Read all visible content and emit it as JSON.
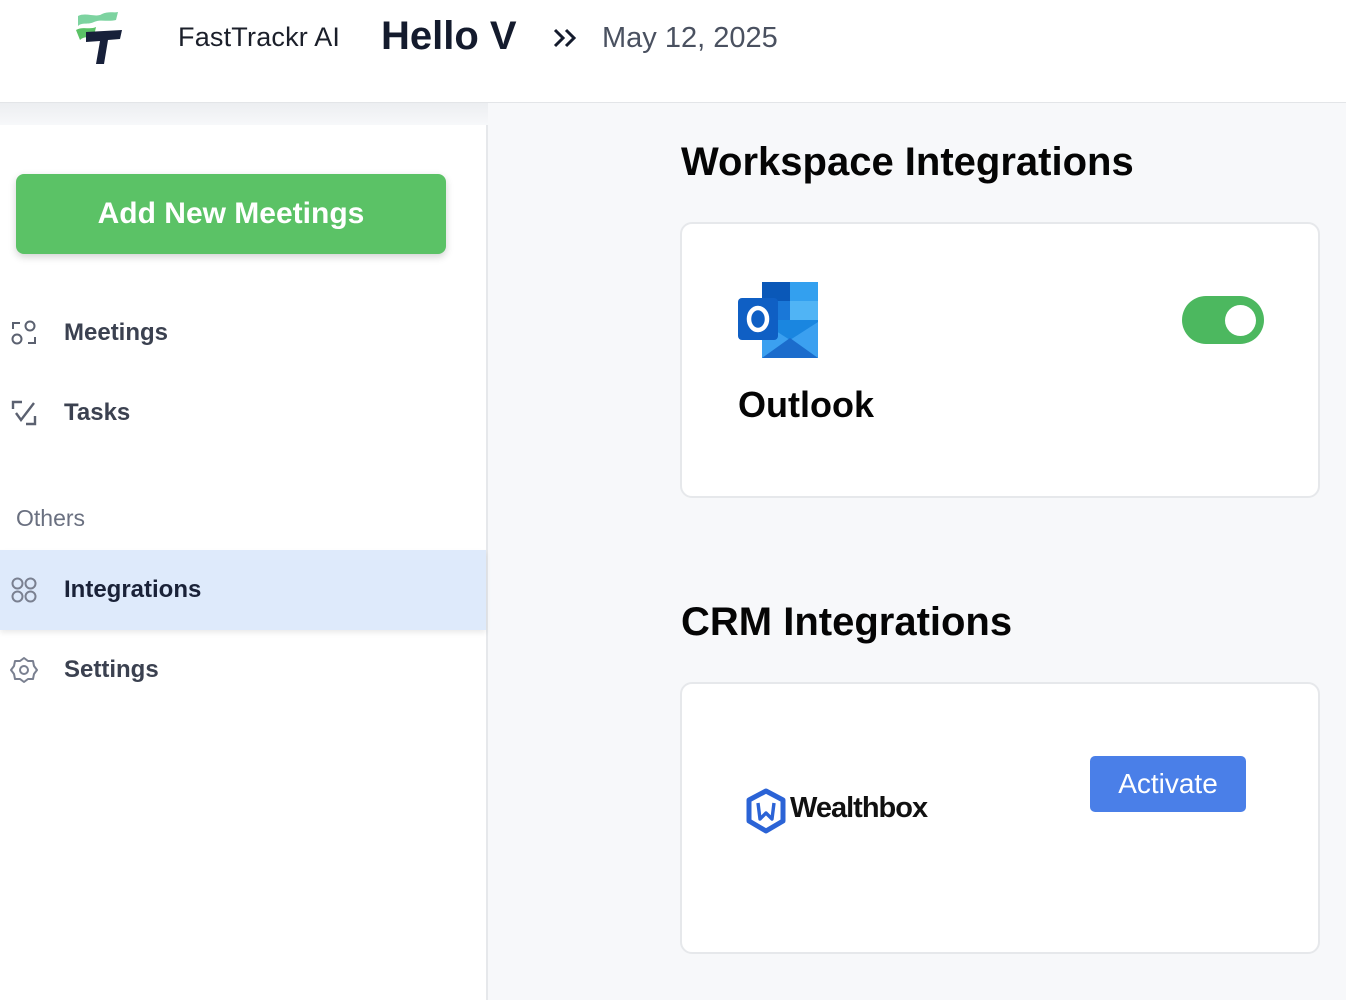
{
  "header": {
    "app_name": "FastTrackr AI",
    "greeting": "Hello V",
    "date": "May 12, 2025"
  },
  "sidebar": {
    "add_button_label": "Add New Meetings",
    "items": [
      {
        "label": "Meetings",
        "icon": "meetings-icon"
      },
      {
        "label": "Tasks",
        "icon": "tasks-icon"
      }
    ],
    "section_label": "Others",
    "other_items": [
      {
        "label": "Integrations",
        "icon": "integrations-icon",
        "active": true
      },
      {
        "label": "Settings",
        "icon": "settings-icon"
      }
    ]
  },
  "main": {
    "workspace": {
      "title": "Workspace Integrations",
      "card": {
        "name": "Outlook",
        "icon": "outlook-icon",
        "enabled": true
      }
    },
    "crm": {
      "title": "CRM Integrations",
      "card": {
        "name": "Wealthbox",
        "icon": "wealthbox-logo",
        "button_label": "Activate"
      }
    }
  },
  "colors": {
    "primary_green": "#5bc266",
    "toggle_green": "#4cb85f",
    "activate_blue": "#4a7fe8",
    "active_nav_bg": "#deeafb"
  }
}
